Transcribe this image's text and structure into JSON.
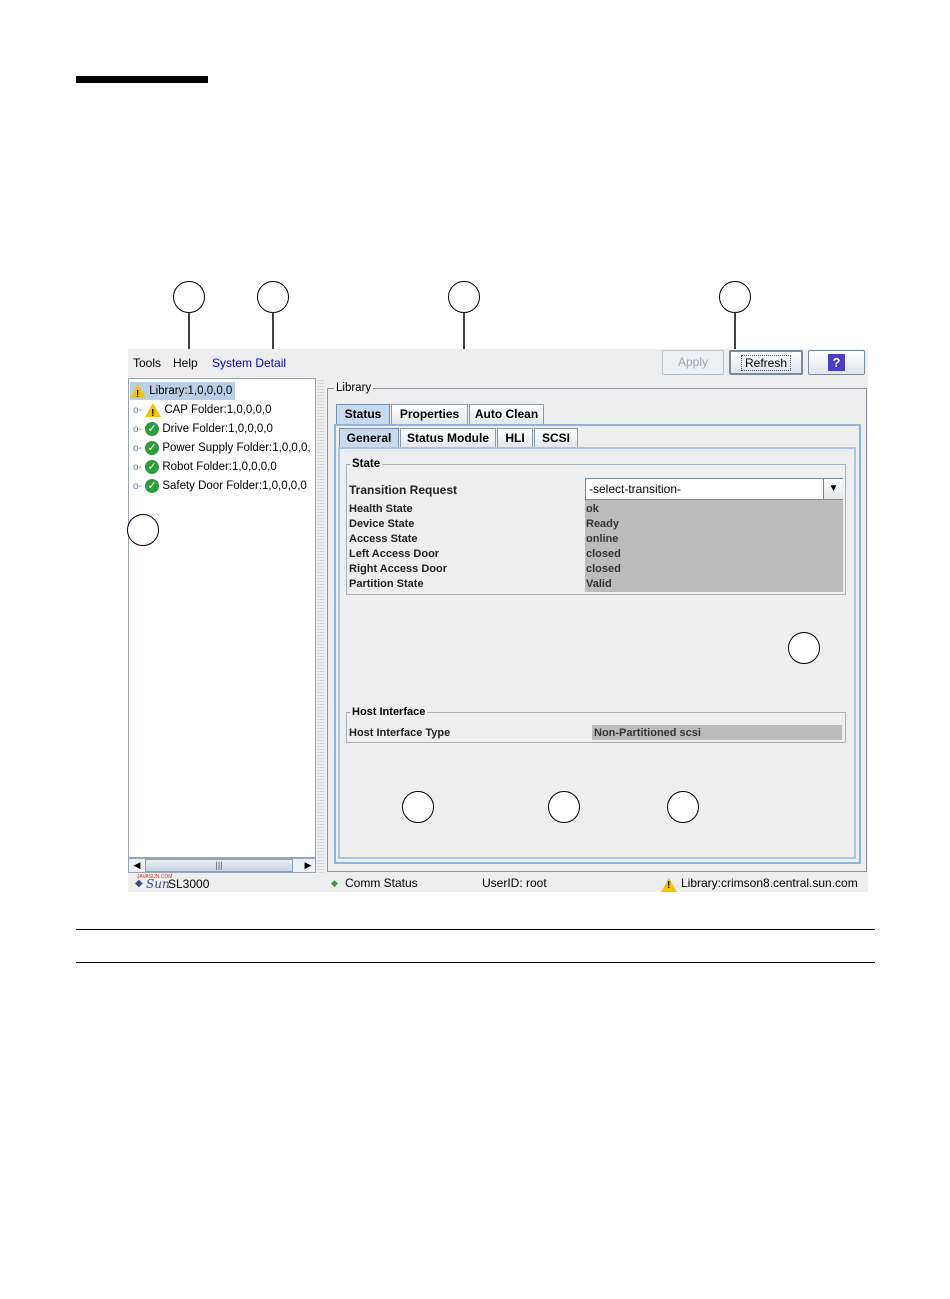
{
  "menubar": {
    "items": [
      "Tools",
      "Help",
      "System Detail"
    ],
    "apply_label": "Apply",
    "refresh_label": "Refresh",
    "help_icon_label": "?"
  },
  "tree": {
    "root": "Library:1,0,0,0,0",
    "items": [
      {
        "label": "CAP Folder:1,0,0,0,0",
        "status": "warning"
      },
      {
        "label": "Drive Folder:1,0,0,0,0",
        "status": "ok"
      },
      {
        "label": "Power Supply Folder:1,0,0,0,",
        "status": "ok"
      },
      {
        "label": "Robot Folder:1,0,0,0,0",
        "status": "ok"
      },
      {
        "label": "Safety Door Folder:1,0,0,0,0",
        "status": "ok"
      }
    ],
    "scroll_thumb_glyph": "|||"
  },
  "panel": {
    "title": "Library",
    "tabs": [
      "Status",
      "Properties",
      "Auto Clean"
    ],
    "subtabs": [
      "General",
      "Status Module",
      "HLI",
      "SCSI"
    ]
  },
  "state": {
    "title": "State",
    "transition_label": "Transition Request",
    "transition_value": "-select-transition-",
    "rows": [
      {
        "label": "Health State",
        "value": "ok"
      },
      {
        "label": "Device State",
        "value": "Ready"
      },
      {
        "label": "Access State",
        "value": "online"
      },
      {
        "label": "Left Access Door",
        "value": "closed"
      },
      {
        "label": "Right Access Door",
        "value": "closed"
      },
      {
        "label": "Partition State",
        "value": "Valid"
      }
    ]
  },
  "host_interface": {
    "title": "Host Interface",
    "label": "Host Interface Type",
    "value": "Non-Partitioned scsi"
  },
  "status_bar": {
    "logo_small": "JAVASUN.COM",
    "logo": "Sun",
    "product": "SL3000",
    "comm_status": "Comm Status",
    "user": "UserID: root",
    "library": "Library:crimson8.central.sun.com"
  },
  "colors": {
    "selection": "#b8cfe5",
    "ok_icon": "#2e9c3a",
    "warning_icon": "#f2c500",
    "help_button": "#4a3fc4",
    "menu_highlight": "#0000c0"
  }
}
